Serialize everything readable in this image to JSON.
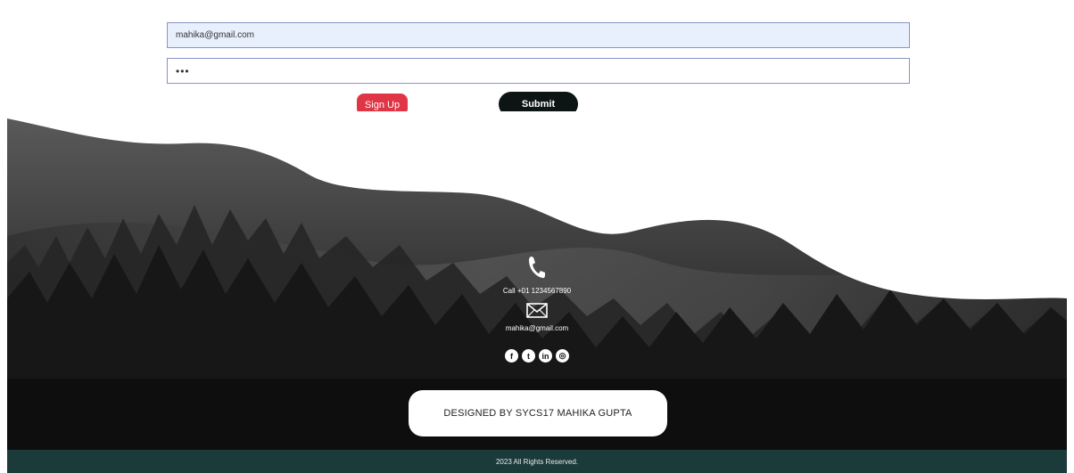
{
  "form": {
    "email_value": "mahika@gmail.com",
    "password_value": "•••",
    "signup_label": "Sign Up",
    "submit_label": "Submit"
  },
  "footer": {
    "phone_text": "Call +01 1234567890",
    "email_text": "mahika@gmail.com",
    "socials": [
      {
        "icon": "facebook-icon",
        "glyph": "f"
      },
      {
        "icon": "twitter-icon",
        "glyph": "t"
      },
      {
        "icon": "linkedin-icon",
        "glyph": "in"
      },
      {
        "icon": "instagram-icon",
        "glyph": "◎"
      }
    ],
    "designed_by": "DESIGNED BY SYCS17 MAHIKA GUPTA",
    "copyright": "2023 All Rights Reserved."
  },
  "colors": {
    "signup_bg": "#e03545",
    "submit_bg": "#0d1414",
    "bottom_bar": "#1b3b3b",
    "input_highlight": "#e8f0fe"
  }
}
